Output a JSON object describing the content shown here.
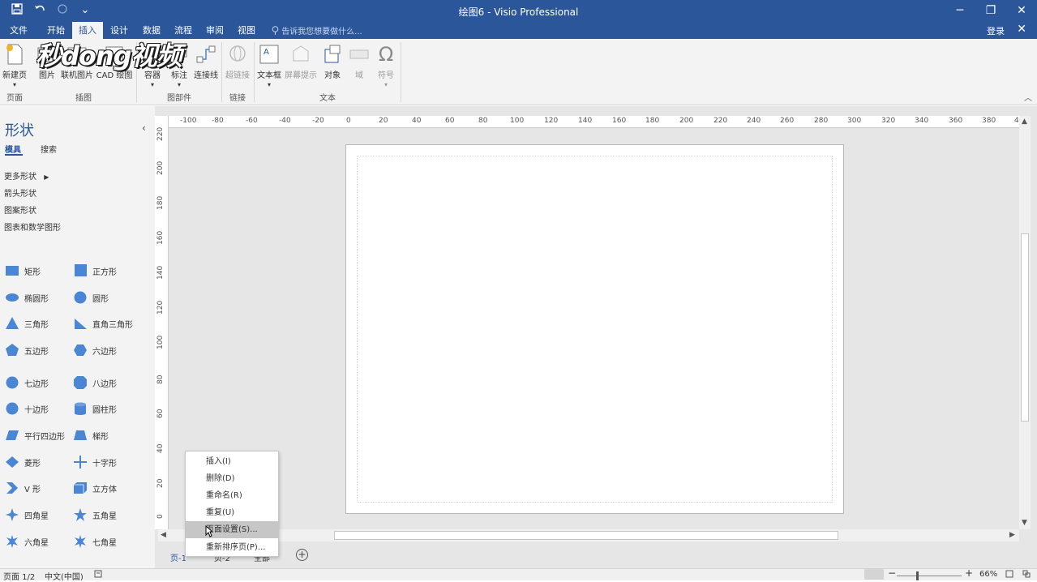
{
  "window": {
    "title": "绘图6 - Visio Professional",
    "minimize": "─",
    "restore": "❐",
    "close": "✕"
  },
  "qat": {
    "save_icon": "save-icon",
    "undo_icon": "undo-icon",
    "redo_icon": "redo-icon",
    "customize": "⌄"
  },
  "menu": {
    "tabs": [
      "文件",
      "开始",
      "插入",
      "设计",
      "数据",
      "流程",
      "审阅",
      "视图"
    ],
    "active_index": 2,
    "tell_me": "告诉我您想要做什么...",
    "login": "登录",
    "close": "✕"
  },
  "ribbon": {
    "buttons": [
      "新建页",
      "图片",
      "联机图片",
      "CAD 绘图",
      "容器",
      "标注",
      "连接线",
      "超链接",
      "文本框",
      "屏幕提示",
      "对象",
      "域",
      "符号"
    ],
    "groups": [
      "页面",
      "插图",
      "图部件",
      "链接",
      "文本"
    ],
    "collapse": "︿"
  },
  "watermark": "秒dong视频",
  "shapes_panel": {
    "title": "形状",
    "tab_stencils": "模具",
    "tab_search": "搜索",
    "collapse": "‹",
    "stencils": [
      "更多形状",
      "箭头形状",
      "图案形状",
      "图表和数学图形"
    ],
    "more_arrow": "▶",
    "items": [
      "矩形",
      "正方形",
      "椭圆形",
      "圆形",
      "三角形",
      "直角三角形",
      "五边形",
      "六边形",
      "七边形",
      "八边形",
      "十边形",
      "圆柱形",
      "平行四边形",
      "梯形",
      "菱形",
      "十字形",
      "V 形",
      "立方体",
      "四角星",
      "五角星",
      "六角星",
      "七角星"
    ]
  },
  "rulers": {
    "horizontal": [
      "-100",
      "-80",
      "-60",
      "-40",
      "-20",
      "0",
      "20",
      "40",
      "60",
      "80",
      "100",
      "120",
      "140",
      "160",
      "180",
      "200",
      "220",
      "240",
      "260",
      "280",
      "300",
      "320",
      "340",
      "360",
      "380",
      "4"
    ],
    "vertical": [
      "220",
      "200",
      "180",
      "160",
      "140",
      "120",
      "100",
      "80",
      "60",
      "40",
      "20",
      "0"
    ]
  },
  "page_tabs": {
    "tab1": "页-1",
    "tab2": "页-2",
    "tab3": "全部",
    "add": "+"
  },
  "context_menu": {
    "items": [
      "插入(I)",
      "删除(D)",
      "重命名(R)",
      "重复(U)",
      "页面设置(S)...",
      "重新排序页(P)..."
    ],
    "highlighted_index": 4
  },
  "status": {
    "page": "页面 1/2",
    "language": "中文(中国)",
    "zoom": "66%",
    "zoom_minus": "−",
    "zoom_plus": "+"
  },
  "colors": {
    "accent": "#2b579a",
    "shape_fill": "#4a86d4"
  }
}
